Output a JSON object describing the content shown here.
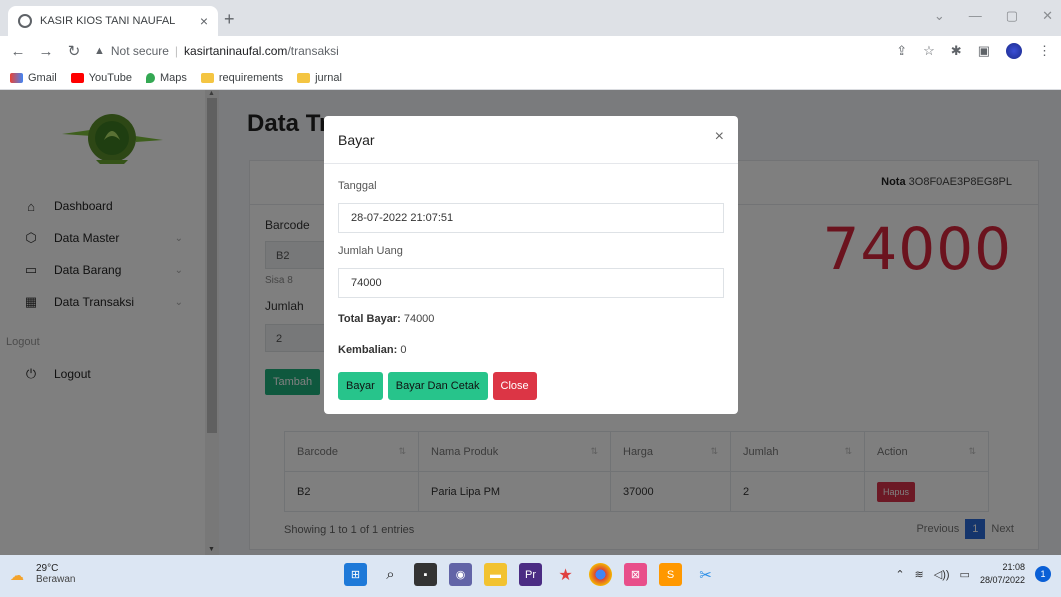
{
  "browser": {
    "tab_title": "KASIR KIOS TANI NAUFAL",
    "security_label": "Not secure",
    "url_domain": "kasirtaninaufal.com",
    "url_path": "/transaksi",
    "bookmarks": [
      "Gmail",
      "YouTube",
      "Maps",
      "requirements",
      "jurnal"
    ]
  },
  "sidebar": {
    "items": [
      {
        "label": "Dashboard",
        "icon": "home-icon"
      },
      {
        "label": "Data Master",
        "icon": "box-icon"
      },
      {
        "label": "Data Barang",
        "icon": "list-icon"
      },
      {
        "label": "Data Transaksi",
        "icon": "grid-icon"
      }
    ],
    "section_logout": "Logout",
    "logout_label": "Logout"
  },
  "main": {
    "title": "Data Tr",
    "nota_label": "Nota",
    "nota_value": "3O8F0AE3P8EG8PL",
    "barcode_label": "Barcode",
    "barcode_value": "B2",
    "sisa_text": "Sisa 8",
    "jumlah_label": "Jumlah",
    "jumlah_value": "2",
    "tambah_label": "Tambah",
    "total_big": "74000",
    "table": {
      "headers": [
        "Barcode",
        "Nama Produk",
        "Harga",
        "Jumlah",
        "Action"
      ],
      "rows": [
        {
          "barcode": "B2",
          "nama": "Paria Lipa PM",
          "harga": "37000",
          "jumlah": "2",
          "action": "Hapus"
        }
      ]
    },
    "showing": "Showing 1 to 1 of 1 entries",
    "pager": {
      "prev": "Previous",
      "current": "1",
      "next": "Next"
    }
  },
  "modal": {
    "title": "Bayar",
    "close": "×",
    "tanggal_label": "Tanggal",
    "tanggal_value": "28-07-2022 21:07:51",
    "jumlah_uang_label": "Jumlah Uang",
    "jumlah_uang_value": "74000",
    "total_bayar_label": "Total Bayar:",
    "total_bayar_value": "74000",
    "kembalian_label": "Kembalian:",
    "kembalian_value": "0",
    "btn_bayar": "Bayar",
    "btn_bayar_cetak": "Bayar Dan Cetak",
    "btn_close": "Close"
  },
  "taskbar": {
    "temp": "29°C",
    "weather": "Berawan",
    "time": "21:08",
    "date": "28/07/2022",
    "notif_count": "1"
  },
  "colors": {
    "accent_green": "#27c48b",
    "danger_red": "#dc3545",
    "total_red": "#d7263d",
    "pager_blue": "#2b6ad9"
  }
}
